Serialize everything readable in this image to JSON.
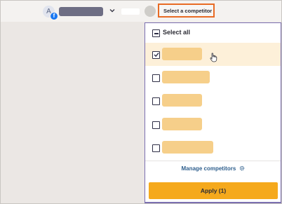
{
  "topbar": {
    "account_initial": "A",
    "account_network_icon": "facebook-icon",
    "competitor_select_label": "Select a competitor"
  },
  "dropdown": {
    "select_all_label": "Select all",
    "items": [
      {
        "checked": true
      },
      {
        "checked": false
      },
      {
        "checked": false
      },
      {
        "checked": false
      },
      {
        "checked": false
      }
    ],
    "manage_label": "Manage competitors",
    "manage_icon": "gear-icon",
    "apply_label": "Apply (1)"
  },
  "colors": {
    "highlight_border": "#e86b25",
    "dropdown_border": "#7b6fb0",
    "apply_button": "#f5a91c",
    "redacted_pill": "#f6cf8a",
    "selected_row": "#fdf0d9",
    "link": "#2f5f8d"
  }
}
